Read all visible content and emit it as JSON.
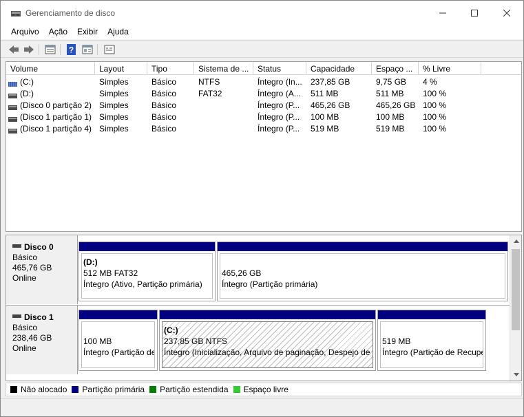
{
  "window": {
    "title": "Gerenciamento de disco",
    "controls": {
      "minimize": "—",
      "maximize": "☐",
      "close": "✕"
    }
  },
  "menu": [
    "Arquivo",
    "Ação",
    "Exibir",
    "Ajuda"
  ],
  "toolbar": {
    "icons": [
      "back-arrow-icon",
      "forward-arrow-icon",
      "disk-list-icon",
      "help-icon",
      "properties-icon",
      "console-icon"
    ],
    "help_glyph": "?"
  },
  "volume_list": {
    "columns": [
      "Volume",
      "Layout",
      "Tipo",
      "Sistema de ...",
      "Status",
      "Capacidade",
      "Espaço ...",
      "% Livre"
    ],
    "rows": [
      {
        "volume": "(C:)",
        "layout": "Simples",
        "tipo": "Básico",
        "sistema": "NTFS",
        "status": "Íntegro (In...",
        "capacidade": "237,85 GB",
        "espaco": "9,75 GB",
        "livre": "4 %",
        "icon": "striped-volume-icon"
      },
      {
        "volume": "(D:)",
        "layout": "Simples",
        "tipo": "Básico",
        "sistema": "FAT32",
        "status": "Íntegro (A...",
        "capacidade": "511 MB",
        "espaco": "511 MB",
        "livre": "100 %",
        "icon": "volume-icon"
      },
      {
        "volume": "(Disco 0 partição 2)",
        "layout": "Simples",
        "tipo": "Básico",
        "sistema": "",
        "status": "Íntegro (P...",
        "capacidade": "465,26 GB",
        "espaco": "465,26 GB",
        "livre": "100 %",
        "icon": "volume-icon"
      },
      {
        "volume": "(Disco 1 partição 1)",
        "layout": "Simples",
        "tipo": "Básico",
        "sistema": "",
        "status": "Íntegro (P...",
        "capacidade": "100 MB",
        "espaco": "100 MB",
        "livre": "100 %",
        "icon": "volume-icon"
      },
      {
        "volume": "(Disco 1 partição 4)",
        "layout": "Simples",
        "tipo": "Básico",
        "sistema": "",
        "status": "Íntegro (P...",
        "capacidade": "519 MB",
        "espaco": "519 MB",
        "livre": "100 %",
        "icon": "volume-icon"
      }
    ]
  },
  "disks": [
    {
      "name": "Disco 0",
      "type": "Básico",
      "size": "465,76 GB",
      "state": "Online",
      "partitions": [
        {
          "name": "(D:)",
          "size": "512 MB FAT32",
          "status": "Íntegro (Ativo, Partição primária)"
        },
        {
          "name": "",
          "size": "465,26 GB",
          "status": "Íntegro (Partição primária)"
        }
      ]
    },
    {
      "name": "Disco 1",
      "type": "Básico",
      "size": "238,46 GB",
      "state": "Online",
      "partitions": [
        {
          "name": "",
          "size": "100 MB",
          "status": "Íntegro (Partição de"
        },
        {
          "name": "(C:)",
          "size": "237,85 GB NTFS",
          "status": "Íntegro (Inicialização, Arquivo de paginação, Despejo de m"
        },
        {
          "name": "",
          "size": "519 MB",
          "status": "Íntegro (Partição de Recupe"
        }
      ]
    }
  ],
  "legend": [
    {
      "label": "Não alocado",
      "color": "#000000"
    },
    {
      "label": "Partição primária",
      "color": "#000080"
    },
    {
      "label": "Partição estendida",
      "color": "#008000"
    },
    {
      "label": "Espaço livre",
      "color": "#33cc33"
    }
  ],
  "colors": {
    "partition_bar": "#000080",
    "window_bg": "#f0f0f0"
  }
}
